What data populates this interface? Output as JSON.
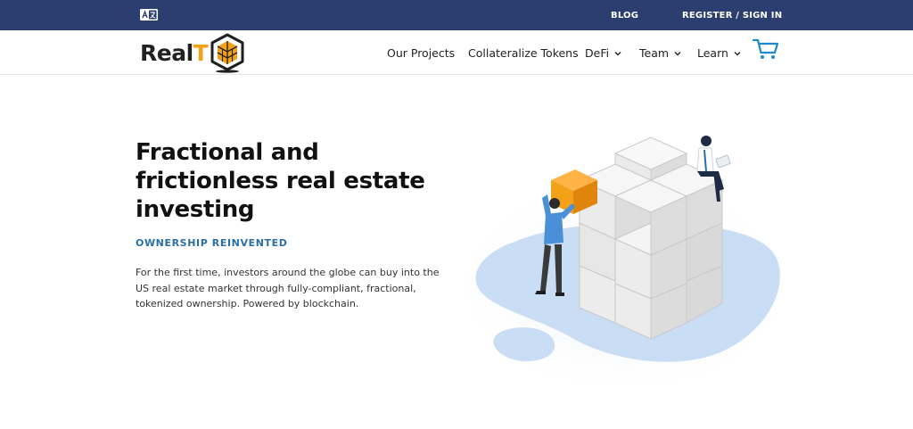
{
  "topbar": {
    "language_icon": "translate-icon",
    "blog": "BLOG",
    "register": "REGISTER / SIGN IN"
  },
  "logo": {
    "text_main": "Real",
    "text_accent": "T",
    "icon": "hexagon-house-logo"
  },
  "nav": {
    "items": [
      {
        "label": "Our Projects"
      },
      {
        "label": "Collateralize Tokens"
      },
      {
        "label": "DeFi",
        "dropdown": true
      },
      {
        "label": "Team",
        "dropdown": true
      },
      {
        "label": "Learn",
        "dropdown": true
      }
    ],
    "cart_icon": "cart-icon"
  },
  "hero": {
    "title": "Fractional and frictionless real estate investing",
    "subtitle": "OWNERSHIP REINVENTED",
    "description": "For the first time, investors around the globe can buy into the US real estate market through fully-compliant, fractional, tokenized ownership. Powered by blockchain."
  },
  "colors": {
    "topbar": "#2c3e6f",
    "accent_orange": "#f4a11a",
    "subtitle_blue": "#2a6fa8",
    "blob_blue": "#c9ddf5"
  }
}
